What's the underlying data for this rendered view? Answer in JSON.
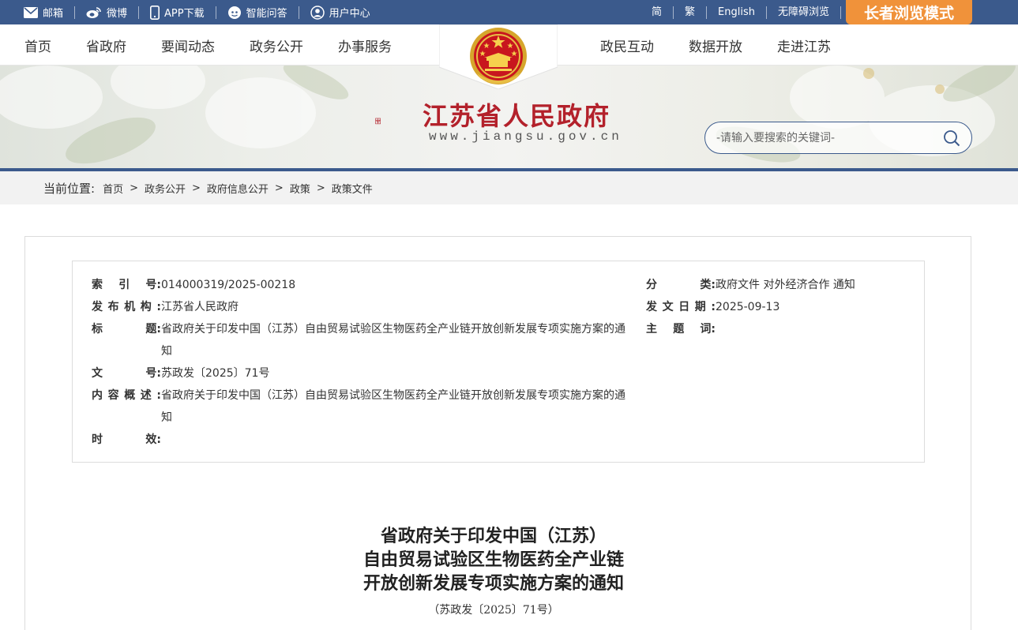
{
  "topbar": {
    "left": [
      {
        "label": "邮箱",
        "icon": "mail-icon"
      },
      {
        "label": "微博",
        "icon": "weibo-icon"
      },
      {
        "label": "APP下载",
        "icon": "phone-icon"
      },
      {
        "label": "智能问答",
        "icon": "chat-bot-icon"
      },
      {
        "label": "用户中心",
        "icon": "user-icon"
      }
    ],
    "right": [
      "简",
      "繁",
      "English",
      "无障碍浏览"
    ],
    "elder_mode": "长者浏览模式",
    "bg_color": "#3b5a8c",
    "elder_color": "#f0923a"
  },
  "nav": {
    "left": [
      "首页",
      "省政府",
      "要闻动态",
      "政务公开",
      "办事服务"
    ],
    "right": [
      "政民互动",
      "数据开放",
      "走进江苏"
    ]
  },
  "banner": {
    "site_name": "江苏省人民政府",
    "site_url": "www.jiangsu.gov.cn",
    "search_placeholder": "-请输入要搜索的关键词-"
  },
  "breadcrumb": {
    "label": "当前位置:",
    "items": [
      "首页",
      "政务公开",
      "政府信息公开",
      "政策",
      "政策文件"
    ]
  },
  "meta": {
    "index_label": "索 引 号:",
    "index_value": "014000319/2025-00218",
    "category_label": "分 类:",
    "category_value": "政府文件 对外经济合作 通知",
    "publisher_label": "发布机构:",
    "publisher_value": "江苏省人民政府",
    "date_label": "发文日期:",
    "date_value": "2025-09-13",
    "title_label": "标 题:",
    "title_value": "省政府关于印发中国（江苏）自由贸易试验区生物医药全产业链开放创新发展专项实施方案的通知",
    "subject_label": "主 题 词:",
    "subject_value": "",
    "docno_label": "文 号:",
    "docno_value": "苏政发〔2025〕71号",
    "summary_label": "内容概述:",
    "summary_value": "省政府关于印发中国（江苏）自由贸易试验区生物医药全产业链开放创新发展专项实施方案的通知",
    "validity_label": "时 效:",
    "validity_value": ""
  },
  "document": {
    "title_lines": [
      "省政府关于印发中国（江苏）",
      "自由贸易试验区生物医药全产业链",
      "开放创新发展专项实施方案的通知"
    ],
    "doc_number": "（苏政发〔2025〕71号）"
  }
}
